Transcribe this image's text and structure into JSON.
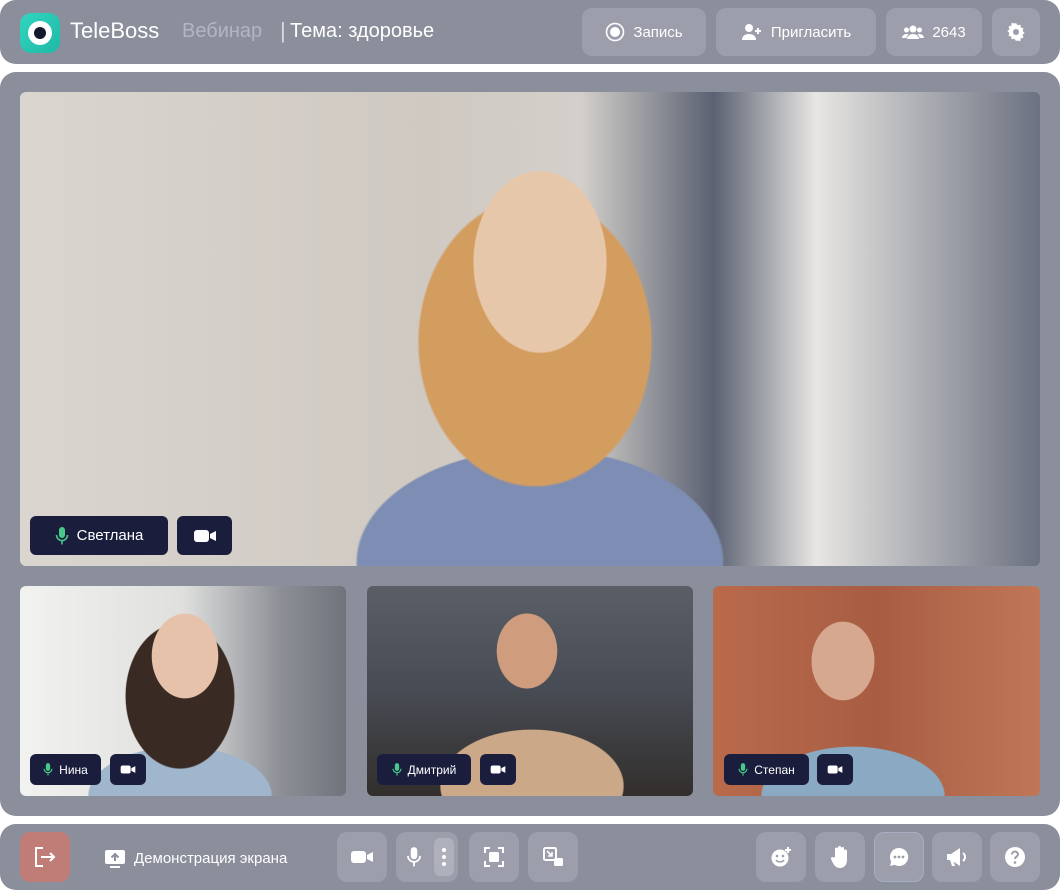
{
  "header": {
    "brand": "TeleBoss",
    "subtitle": "Вебинар",
    "separator": "|",
    "topic": "Тема: здоровье",
    "record_label": "Запись",
    "invite_label": "Пригласить",
    "participants_count": "2643"
  },
  "participants": {
    "main": {
      "name": "Светлана"
    },
    "tiles": [
      {
        "name": "Нина"
      },
      {
        "name": "Дмитрий"
      },
      {
        "name": "Степан"
      }
    ]
  },
  "toolbar": {
    "screenshare_label": "Демонстрация экрана"
  },
  "colors": {
    "panel": "#8b8e9b",
    "button": "#9c9eab",
    "leave": "#c07c76",
    "name_tag": "#1a1e3c",
    "brand_accent": "#1fb9a6",
    "mic_green": "#46c98a"
  }
}
